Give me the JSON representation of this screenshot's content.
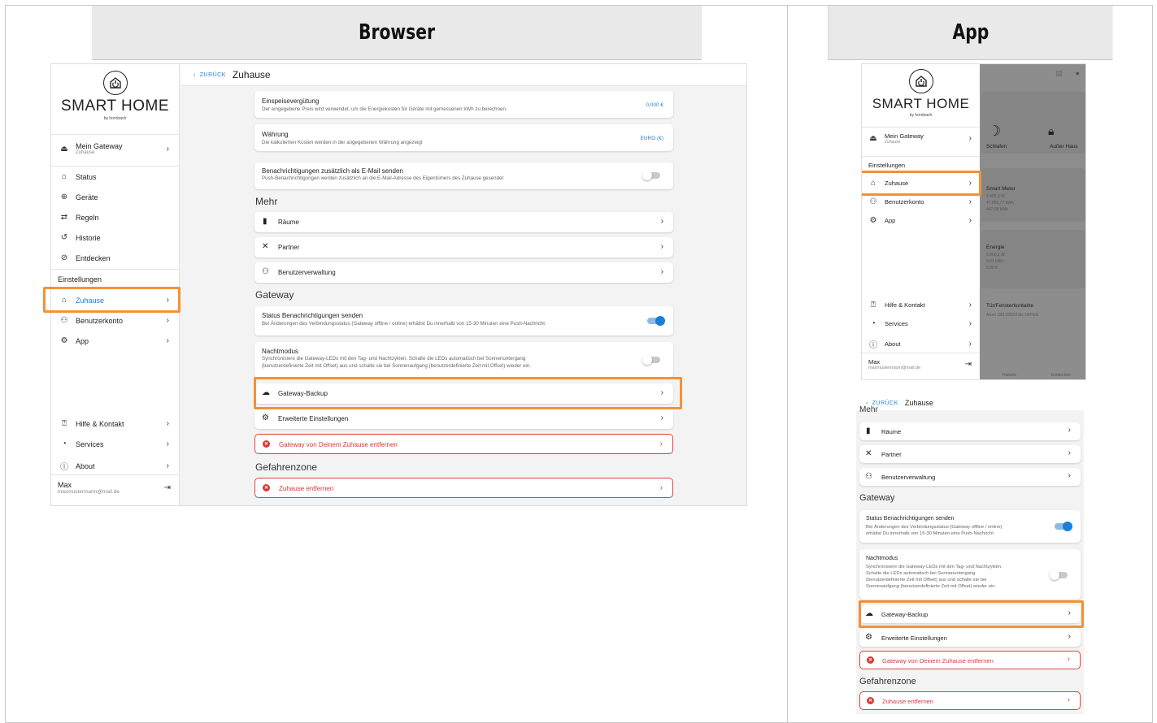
{
  "headers": {
    "browser": "Browser",
    "app": "App"
  },
  "brand": {
    "name": "SMART HOME",
    "sub": "by hornbach"
  },
  "sidebar": {
    "gateway": {
      "label": "Mein Gateway",
      "sub": "Zuhause"
    },
    "nav": [
      {
        "label": "Status"
      },
      {
        "label": "Geräte"
      },
      {
        "label": "Regeln"
      },
      {
        "label": "Historie"
      },
      {
        "label": "Entdecken"
      }
    ],
    "settings_label": "Einstellungen",
    "settings": [
      {
        "label": "Zuhause"
      },
      {
        "label": "Benutzerkonto"
      },
      {
        "label": "App"
      }
    ],
    "help": [
      {
        "label": "Hilfe & Kontakt"
      },
      {
        "label": "Services"
      },
      {
        "label": "About"
      }
    ],
    "user": {
      "name": "Max",
      "email": "maxmustermann@mail.de"
    }
  },
  "topbar": {
    "back": "ZURÜCK",
    "title": "Zuhause"
  },
  "content": {
    "feed_in": {
      "title": "Einspeisevergütung",
      "desc": "Der eingegebene Preis wird verwendet, um die Energiekosten für Geräte mit gemessenen kWh zu berechnen.",
      "value": "0,000 €"
    },
    "currency": {
      "title": "Währung",
      "desc": "Die kalkulierten Kosten werden in der angegebenen Währung angezeigt",
      "value": "EURO (€)"
    },
    "email_notif": {
      "title": "Benachrichtigungen zusätzlich als E-Mail senden",
      "desc": "Push-Benachrichtigungen werden zusätzlich an die E-Mail-Adresse des Eigentümers des Zuhause gesendet",
      "on": false
    },
    "more_heading": "Mehr",
    "more": [
      {
        "label": "Räume",
        "icon": "door-icon"
      },
      {
        "label": "Partner",
        "icon": "partner-icon"
      },
      {
        "label": "Benutzerverwaltung",
        "icon": "users-icon"
      }
    ],
    "gateway_heading": "Gateway",
    "status_notif": {
      "title": "Status Benachrichtigungen senden",
      "desc": "Bei Änderungen des Verbindungsstatus (Gateway offline / online) erhältst Du innerhalb von 15-30 Minuten eine Push-Nachricht",
      "on": true
    },
    "night_mode": {
      "title": "Nachtmodus",
      "desc1": "Synchronisiere die Gateway-LEDs mit den Tag- und Nachtzyklen. Schalte die LEDs automatisch bei Sonnenuntergang",
      "desc2": "(benutzerdefinierte Zeit mit Offset) aus und schalte sie bei Sonnenaufgang (benutzerdefinierte Zeit mit Offset) wieder ein.",
      "on": false
    },
    "backup": {
      "label": "Gateway-Backup"
    },
    "advanced": {
      "label": "Erweiterte Einstellungen"
    },
    "remove_gateway": {
      "label": "Gateway von Deinem Zuhause entfernen"
    },
    "danger_heading": "Gefahrenzone",
    "remove_home": {
      "label": "Zuhause entfernen"
    }
  },
  "app_top": {
    "scenes": [
      {
        "label": "Schlafen"
      },
      {
        "label": "Außer Haus"
      }
    ],
    "tiles": [
      {
        "title": "Smart Meter",
        "lines": [
          "4.493,3 W",
          "47.855,77 kWh",
          "447,03 kWh"
        ]
      },
      {
        "title": "Energie",
        "lines": [
          "5.000,2 W",
          "9,01 kWh",
          "0,00 €"
        ]
      },
      {
        "title": "Tür/Fensterkontakte",
        "lines": [
          "Arum 19/11/2023 bis OFFEN"
        ]
      }
    ],
    "bottom_nav": [
      {
        "label": "Historie"
      },
      {
        "label": "Entdecken"
      }
    ]
  },
  "app_bottom": {
    "cut_heading": "Mehr",
    "status_desc1": "Bei Änderungen des Verbindungsstatus (Gateway offline / online)",
    "status_desc2": "erhältst Du innerhalb von 15-30 Minuten eine Push-Nachricht",
    "night_desc1": "Synchronisiere die Gateway-LEDs mit den Tag- und Nachtzyklen.",
    "night_desc2": "Schalte die LEDs automatisch bei Sonnenuntergang",
    "night_desc3": "(benutzerdefinierte Zeit mit Offset) aus und schalte sie bei",
    "night_desc4": "Sonnenaufgang (benutzerdefinierte Zeit mit Offset) wieder ein."
  },
  "colors": {
    "accent": "#1a7fd6",
    "highlight": "#f39235",
    "danger": "#d93838"
  }
}
